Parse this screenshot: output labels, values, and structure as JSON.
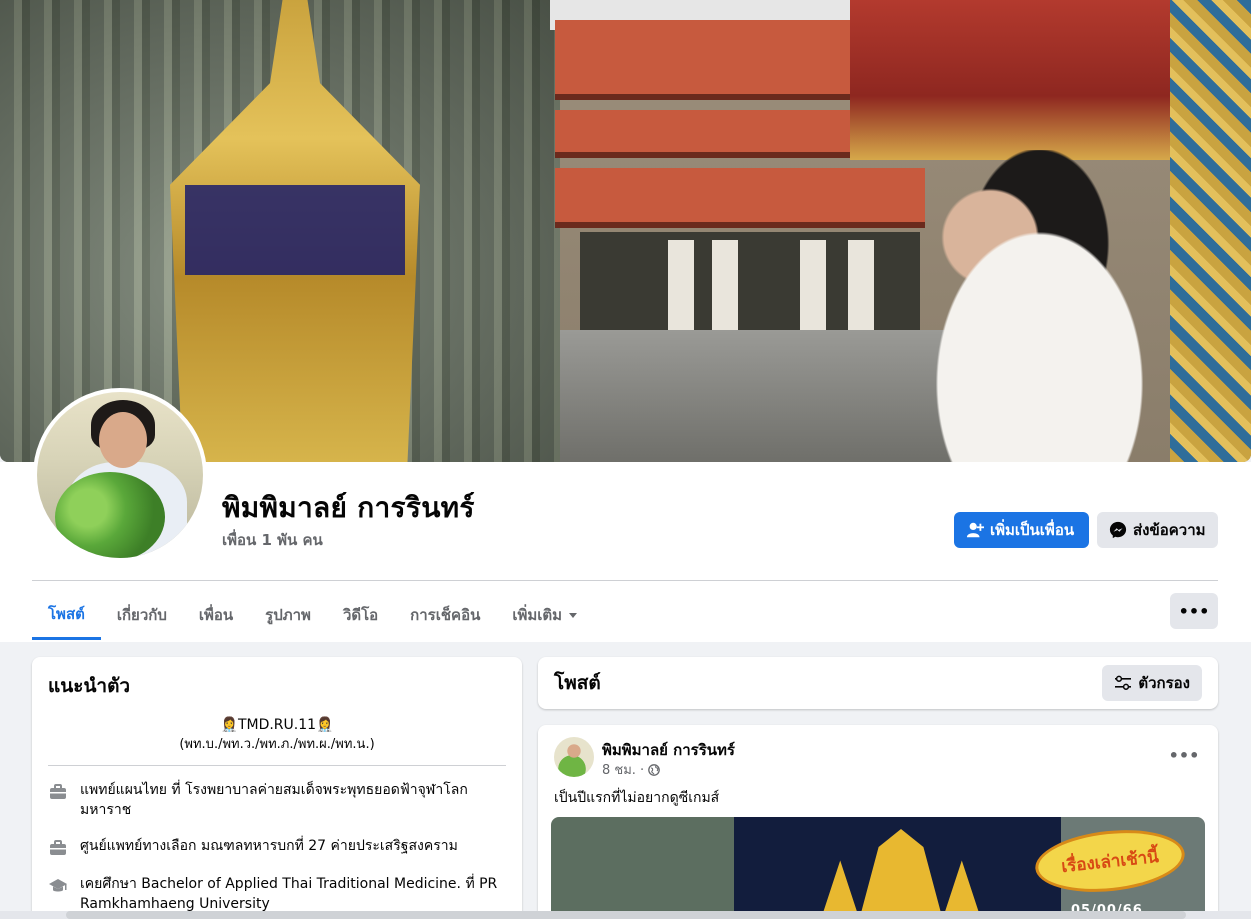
{
  "profile": {
    "name": "พิมพิมาลย์ การรินทร์",
    "friends": "เพื่อน 1 พัน คน",
    "add_friend_label": "เพิ่มเป็นเพื่อน",
    "message_label": "ส่งข้อความ"
  },
  "tabs": [
    {
      "label": "โพสต์",
      "active": true
    },
    {
      "label": "เกี่ยวกับ"
    },
    {
      "label": "เพื่อน"
    },
    {
      "label": "รูปภาพ"
    },
    {
      "label": "วิดีโอ"
    },
    {
      "label": "การเช็คอิน"
    },
    {
      "label": "เพิ่มเติม"
    }
  ],
  "more_button": "•••",
  "intro": {
    "title": "แนะนำตัว",
    "bio_line1": "👩‍⚕️TMD.RU.11👩‍⚕️",
    "bio_line2": "(พท.บ./พท.ว./พท.ภ./พท.ผ./พท.น.)",
    "items": [
      {
        "icon": "briefcase-icon",
        "text": "แพทย์แผนไทย ที่ โรงพยาบาลค่ายสมเด็จพระพุทธยอดฟ้าจุฬาโลกมหาราช"
      },
      {
        "icon": "briefcase-icon",
        "text": "ศูนย์แพทย์ทางเลือก มณฑลทหารบกที่ 27 ค่ายประเสริฐสงคราม"
      },
      {
        "icon": "graduation-cap-icon",
        "text": "เคยศึกษา Bachelor of Applied Thai Traditional Medicine. ที่ PR Ramkhamhaeng University"
      }
    ]
  },
  "posts_header": {
    "title": "โพสต์",
    "filter_label": "ตัวกรอง"
  },
  "post": {
    "author": "พิมพิมาลย์ การรินทร์",
    "time": "8 ชม. ·",
    "privacy_icon": "globe-icon",
    "text": "เป็นปีแรกที่ไม่อยากดูซีเกมส์",
    "more": "•••",
    "media_badge": "เรื่องเล่าเช้านี้",
    "media_date": "05/00/66"
  },
  "colors": {
    "primary": "#1b74e4",
    "secondary_bg": "#e4e6eb",
    "page_bg": "#f0f2f5",
    "muted_text": "#65676b"
  }
}
